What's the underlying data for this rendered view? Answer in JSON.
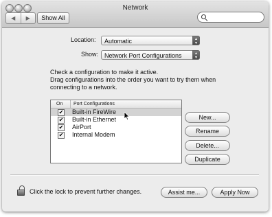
{
  "window": {
    "title": "Network",
    "search_placeholder": ""
  },
  "toolbar": {
    "back_glyph": "◀",
    "forward_glyph": "▶",
    "show_all": "Show All"
  },
  "location": {
    "label": "Location:",
    "value": "Automatic"
  },
  "show": {
    "label": "Show:",
    "value": "Network Port Configurations"
  },
  "instructions": {
    "line1": "Check a configuration to make it active.",
    "line2": "Drag configurations into the order you want to try them when",
    "line3": "connecting to a network."
  },
  "table": {
    "columns": [
      "On",
      "Port Configurations"
    ],
    "rows": [
      {
        "on": true,
        "name": "Built-in FireWire",
        "selected": true
      },
      {
        "on": true,
        "name": "Built-in Ethernet",
        "selected": false
      },
      {
        "on": true,
        "name": "AirPort",
        "selected": false
      },
      {
        "on": true,
        "name": "Internal Modem",
        "selected": false
      }
    ],
    "check_glyph": "✔"
  },
  "side_buttons": {
    "new": "New...",
    "rename": "Rename",
    "delete": "Delete...",
    "duplicate": "Duplicate"
  },
  "footer": {
    "lock_text": "Click the lock to prevent further changes.",
    "assist": "Assist me...",
    "apply": "Apply Now"
  },
  "icons": {
    "close": "traffic-light-close-icon",
    "minimize": "traffic-light-minimize-icon",
    "zoom": "traffic-light-zoom-icon",
    "search": "search-icon",
    "lock": "lock-icon",
    "cursor": "mouse-pointer-icon"
  },
  "colors": {
    "window_bg": "#ececec",
    "selected_row": "#d3d3d3",
    "popup_arrows": "#5a5a5a"
  }
}
